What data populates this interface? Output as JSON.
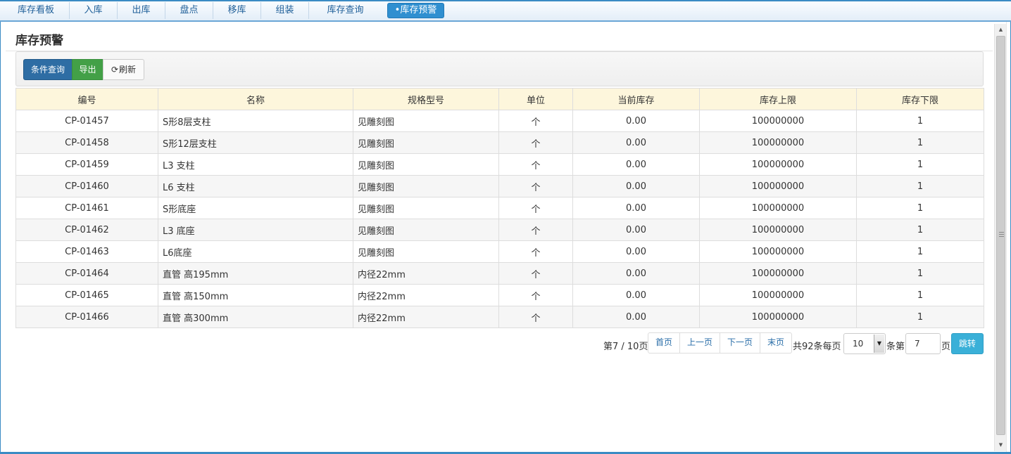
{
  "tabs": [
    {
      "label": "库存看板"
    },
    {
      "label": "入库"
    },
    {
      "label": "出库"
    },
    {
      "label": "盘点"
    },
    {
      "label": "移库"
    },
    {
      "label": "组装"
    },
    {
      "label": "库存查询"
    },
    {
      "label": "•库存预警",
      "active": true
    }
  ],
  "page": {
    "title": "库存预警"
  },
  "toolbar": {
    "query_label": "条件查询",
    "export_label": "导出",
    "refresh_label": "刷新",
    "refresh_icon": "refresh-icon"
  },
  "table": {
    "columns": [
      "编号",
      "名称",
      "规格型号",
      "单位",
      "当前库存",
      "库存上限",
      "库存下限"
    ],
    "rows": [
      [
        "CP-01457",
        "S形8层支柱",
        "见雕刻图",
        "个",
        "0.00",
        "100000000",
        "1"
      ],
      [
        "CP-01458",
        "S形12层支柱",
        "见雕刻图",
        "个",
        "0.00",
        "100000000",
        "1"
      ],
      [
        "CP-01459",
        "L3 支柱",
        "见雕刻图",
        "个",
        "0.00",
        "100000000",
        "1"
      ],
      [
        "CP-01460",
        "L6 支柱",
        "见雕刻图",
        "个",
        "0.00",
        "100000000",
        "1"
      ],
      [
        "CP-01461",
        "S形底座",
        "见雕刻图",
        "个",
        "0.00",
        "100000000",
        "1"
      ],
      [
        "CP-01462",
        "L3 底座",
        "见雕刻图",
        "个",
        "0.00",
        "100000000",
        "1"
      ],
      [
        "CP-01463",
        "L6底座",
        "见雕刻图",
        "个",
        "0.00",
        "100000000",
        "1"
      ],
      [
        "CP-01464",
        "直管 高195mm",
        "内径22mm",
        "个",
        "0.00",
        "100000000",
        "1"
      ],
      [
        "CP-01465",
        "直管 高150mm",
        "内径22mm",
        "个",
        "0.00",
        "100000000",
        "1"
      ],
      [
        "CP-01466",
        "直管 高300mm",
        "内径22mm",
        "个",
        "0.00",
        "100000000",
        "1"
      ]
    ]
  },
  "pager": {
    "page_info": "第7 / 10页",
    "first": "首页",
    "prev": "上一页",
    "next": "下一页",
    "last": "末页",
    "total_text": "共92条每页",
    "page_size": "10",
    "rows_suffix": "条第",
    "page_input": "7",
    "page_suffix": "页",
    "go_label": "跳转"
  }
}
